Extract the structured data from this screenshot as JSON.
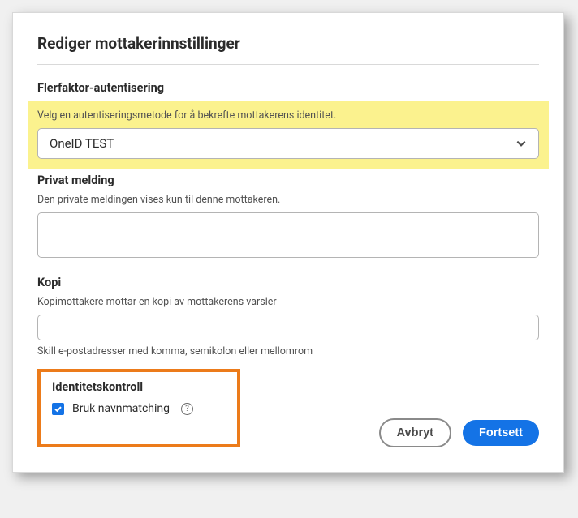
{
  "dialog": {
    "title": "Rediger mottakerinnstillinger"
  },
  "mfa": {
    "label": "Flerfaktor-autentisering",
    "help": "Velg en autentiseringsmetode for å bekrefte mottakerens identitet.",
    "selected": "OneID TEST"
  },
  "privateMessage": {
    "label": "Privat melding",
    "help": "Den private meldingen vises kun til denne mottakeren.",
    "value": ""
  },
  "copy": {
    "label": "Kopi",
    "help": "Kopimottakere mottar en kopi av mottakerens varsler",
    "value": "",
    "hint": "Skill e-postadresser med komma, semikolon eller mellomrom"
  },
  "identity": {
    "label": "Identitetskontroll",
    "checkboxLabel": "Bruk navnmatching",
    "checked": true
  },
  "buttons": {
    "cancel": "Avbryt",
    "continue": "Fortsett"
  }
}
